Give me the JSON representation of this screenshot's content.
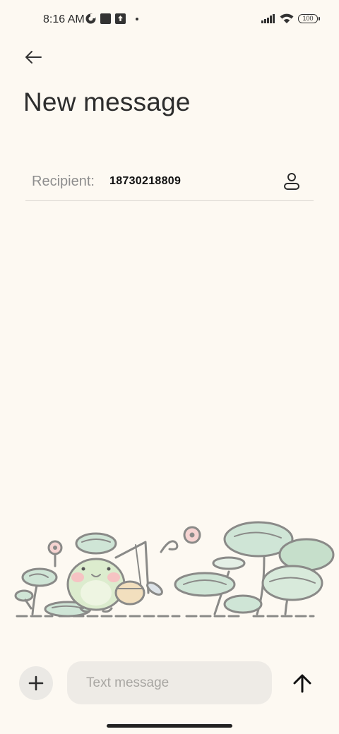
{
  "status_bar": {
    "time": "8:16 AM",
    "battery_level": "100",
    "icons": [
      "vpn-key-icon",
      "notification-square-icon",
      "upload-notification-icon",
      "more-dot-icon",
      "signal-icon",
      "wifi-icon",
      "battery-icon"
    ]
  },
  "header": {
    "back_icon": "arrow-left-icon",
    "title": "New message"
  },
  "recipient": {
    "label": "Recipient:",
    "value": "18730218809",
    "contact_icon": "person-icon"
  },
  "composer": {
    "add_icon": "plus-icon",
    "placeholder": "Text message",
    "value": "",
    "send_icon": "arrow-up-icon"
  },
  "illustration": {
    "subject": "frog-fishing-among-lily-pads"
  },
  "colors": {
    "background": "#fdf9f2",
    "input_background": "#eeebe6",
    "add_button_background": "#ebe9e5",
    "divider": "#d9d6d0",
    "lily_green": "#cfe5d6",
    "outline_gray": "#8a8a88"
  }
}
